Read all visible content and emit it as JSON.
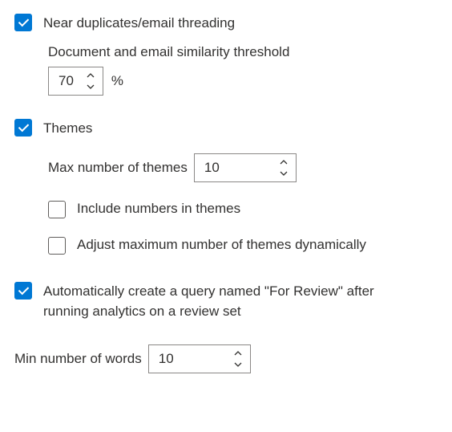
{
  "nearDup": {
    "label": "Near duplicates/email threading",
    "checked": true,
    "thresholdLabel": "Document and email similarity threshold",
    "thresholdValue": "70",
    "thresholdUnit": "%"
  },
  "themes": {
    "label": "Themes",
    "checked": true,
    "maxLabel": "Max number of themes",
    "maxValue": "10",
    "includeNumbers": {
      "label": "Include numbers in themes",
      "checked": false
    },
    "adjustDynamic": {
      "label": "Adjust maximum number of themes dynamically",
      "checked": false
    }
  },
  "autoQuery": {
    "label": "Automatically create a query named \"For Review\" after running analytics on a review set",
    "checked": true
  },
  "minWords": {
    "label": "Min number of words",
    "value": "10"
  }
}
